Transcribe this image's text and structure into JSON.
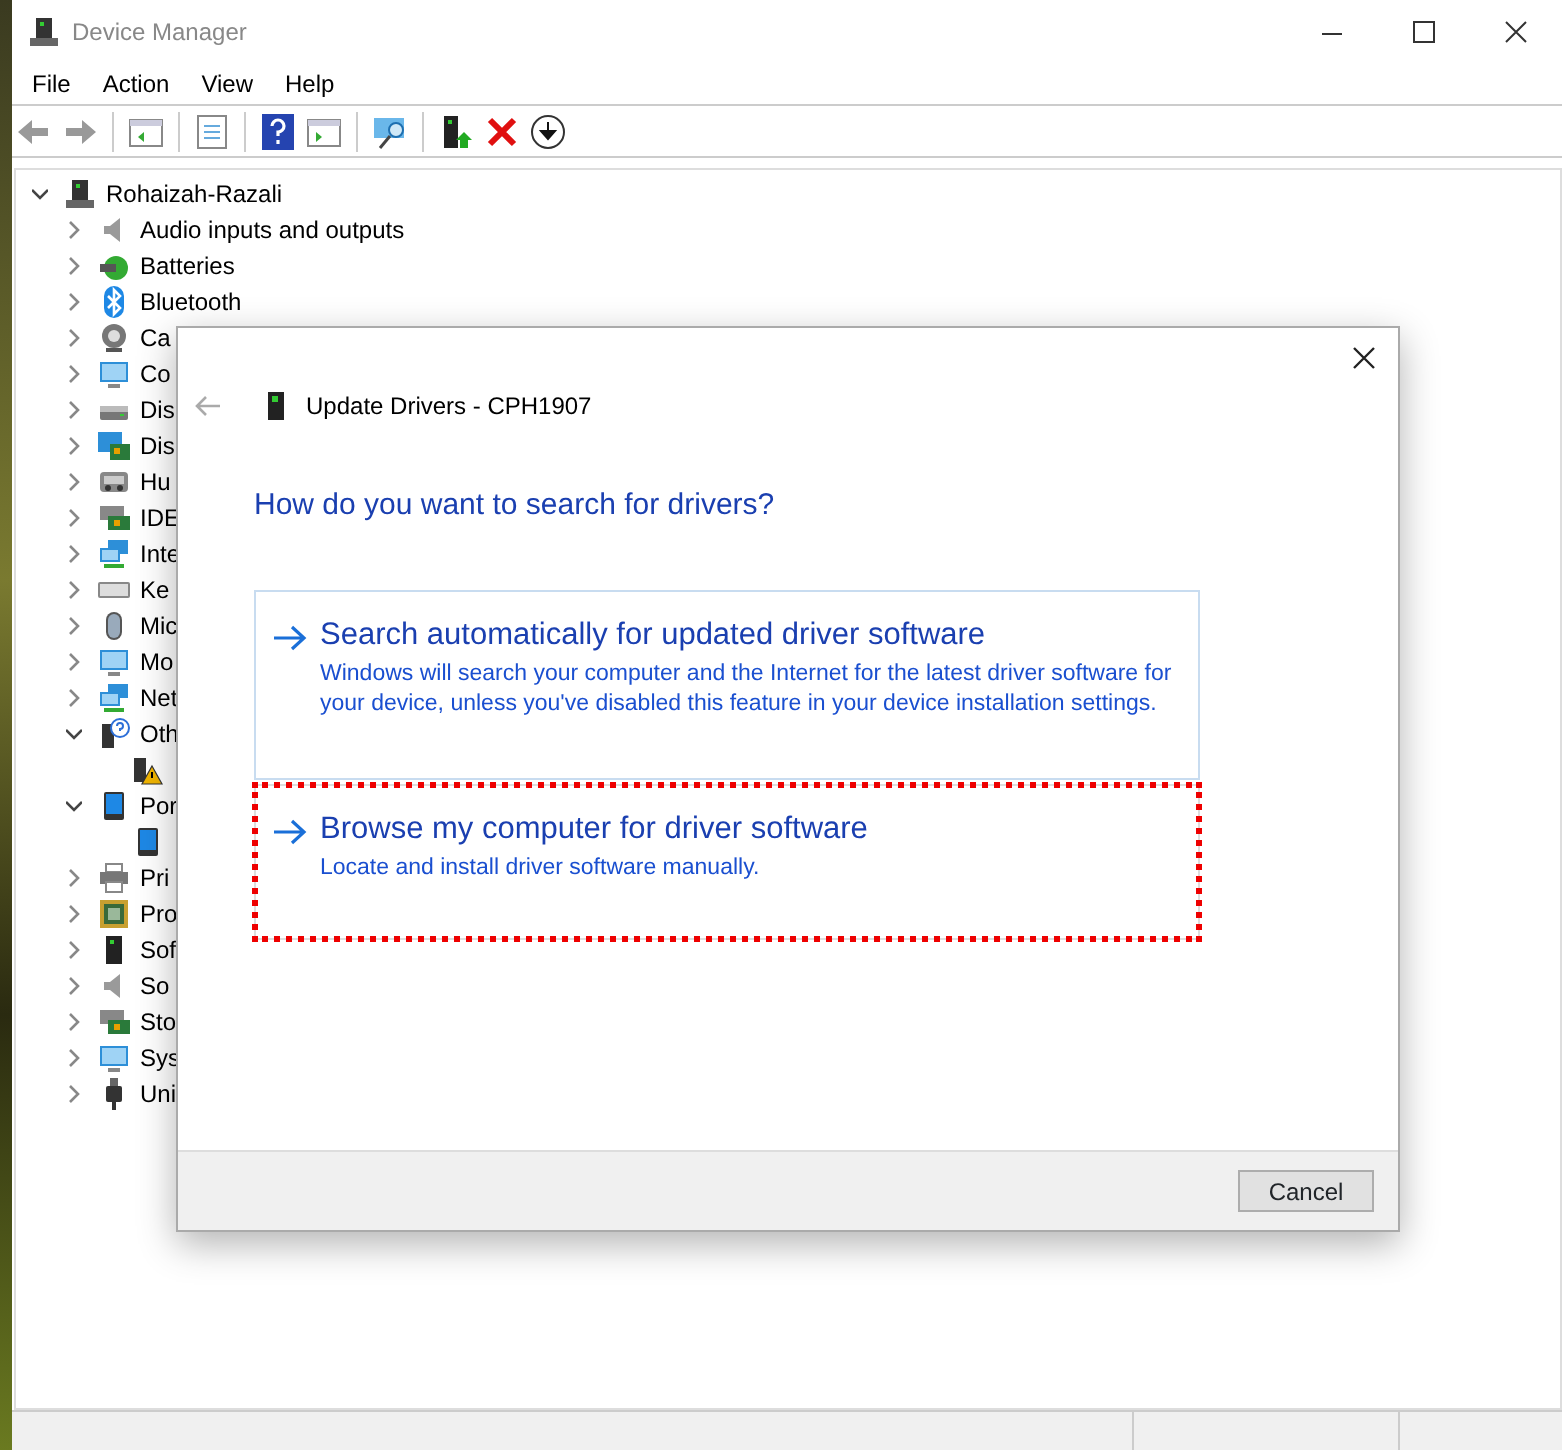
{
  "window": {
    "title": "Device Manager"
  },
  "menu": [
    "File",
    "Action",
    "View",
    "Help"
  ],
  "tree": {
    "label": "Rohaizah-Razali",
    "kind": "computer",
    "expanded": true,
    "children": [
      {
        "label": "Audio inputs and outputs",
        "kind": "speaker",
        "expanded": false
      },
      {
        "label": "Batteries",
        "kind": "battery",
        "expanded": false
      },
      {
        "label": "Bluetooth",
        "kind": "bluetooth",
        "expanded": false
      },
      {
        "label": "Ca",
        "kind": "camera",
        "expanded": false
      },
      {
        "label": "Co",
        "kind": "monitor",
        "expanded": false
      },
      {
        "label": "Dis",
        "kind": "disk",
        "expanded": false
      },
      {
        "label": "Dis",
        "kind": "display",
        "expanded": false
      },
      {
        "label": "Hu",
        "kind": "hid",
        "expanded": false
      },
      {
        "label": "IDE",
        "kind": "card",
        "expanded": false
      },
      {
        "label": "Inte",
        "kind": "network",
        "expanded": false
      },
      {
        "label": "Ke",
        "kind": "keyboard",
        "expanded": false
      },
      {
        "label": "Mic",
        "kind": "mouse",
        "expanded": false
      },
      {
        "label": "Mo",
        "kind": "monitor",
        "expanded": false
      },
      {
        "label": "Net",
        "kind": "network",
        "expanded": false
      },
      {
        "label": "Oth",
        "kind": "unknown",
        "expanded": true,
        "children": [
          {
            "kind": "warning"
          }
        ]
      },
      {
        "label": "Por",
        "kind": "portable",
        "expanded": true,
        "children": [
          {
            "kind": "portable"
          }
        ]
      },
      {
        "label": "Pri",
        "kind": "printer",
        "expanded": false
      },
      {
        "label": "Pro",
        "kind": "chip",
        "expanded": false
      },
      {
        "label": "Sof",
        "kind": "tower",
        "expanded": false
      },
      {
        "label": "So",
        "kind": "speaker",
        "expanded": false
      },
      {
        "label": "Sto",
        "kind": "card",
        "expanded": false
      },
      {
        "label": "Sys",
        "kind": "monitor",
        "expanded": false
      },
      {
        "label": "Uni",
        "kind": "usb",
        "expanded": false
      }
    ]
  },
  "dialog": {
    "title": "Update Drivers - CPH1907",
    "heading": "How do you want to search for drivers?",
    "options": [
      {
        "title": "Search automatically for updated driver software",
        "description": "Windows will search your computer and the Internet for the latest driver software for your device, unless you've disabled this feature in your device installation settings.",
        "highlighted": false
      },
      {
        "title": "Browse my computer for driver software",
        "description": "Locate and install driver software manually.",
        "highlighted": true
      }
    ],
    "buttons": [
      "Cancel"
    ]
  }
}
